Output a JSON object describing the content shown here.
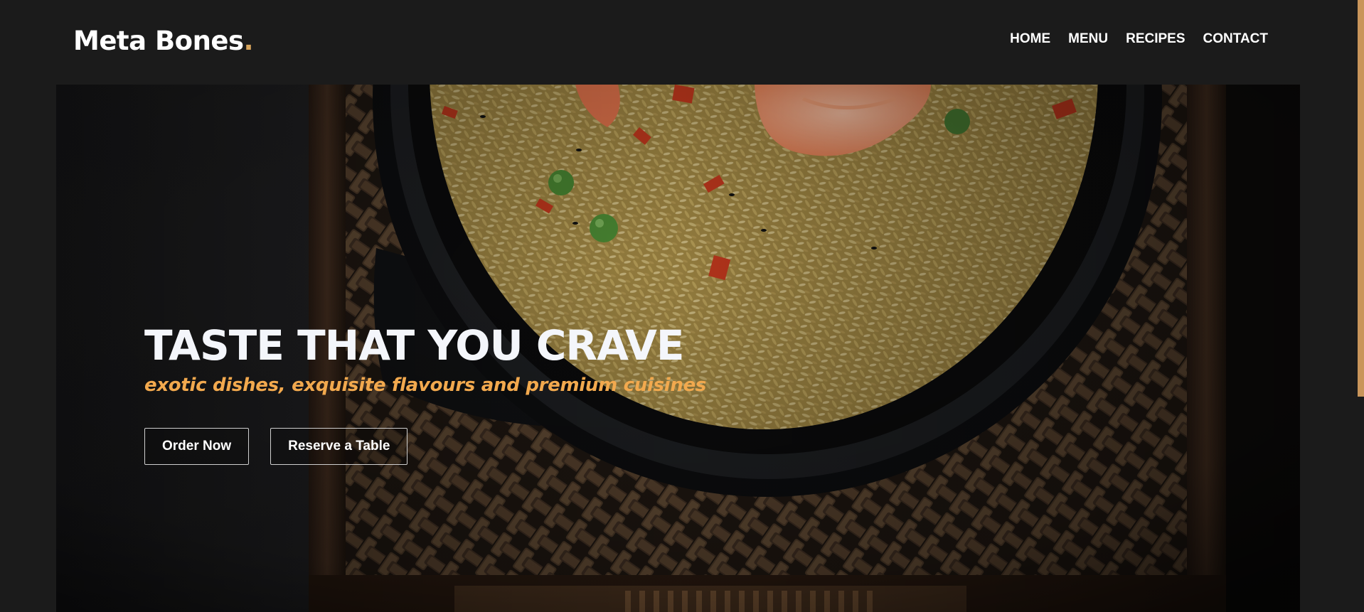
{
  "header": {
    "logo_text": "Meta Bones",
    "logo_dot": ".",
    "nav": [
      {
        "label": "HOME"
      },
      {
        "label": "MENU"
      },
      {
        "label": "RECIPES"
      },
      {
        "label": "CONTACT"
      }
    ]
  },
  "hero": {
    "title": "TASTE THAT YOU CRAVE",
    "subtitle": "exotic dishes, exquisite flavours and premium cuisines",
    "buttons": {
      "order": "Order Now",
      "reserve": "Reserve a Table"
    }
  },
  "colors": {
    "background": "#1b1b1b",
    "accent": "#d6a35b",
    "subtitle": "#f2a94e",
    "title": "#f4f6fb"
  }
}
